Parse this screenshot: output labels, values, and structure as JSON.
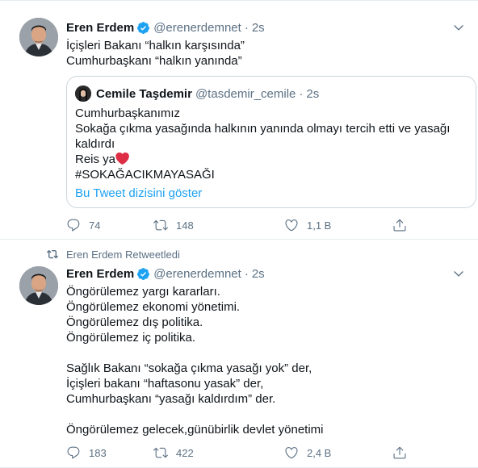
{
  "tweet1": {
    "author_name": "Eren Erdem",
    "handle": "@erenerdemnet",
    "separator": "·",
    "time": "2s",
    "text": "İçişleri Bakanı “halkın karşısında”\nCumhurbaşkanı “halkın yanında”",
    "quote": {
      "author_name": "Cemile Taşdemir",
      "handle": "@tasdemir_cemile",
      "separator": "·",
      "time": "2s",
      "text_before_heart": "Cumhurbaşkanımız\nSokağa çıkma yasağında halkının yanında olmayı tercih etti ve yasağı kaldırdı\nReis ya",
      "text_after_heart": "\n #SOKAĞACIKMAYASAĞI",
      "thread_link": "Bu Tweet dizisini göster"
    },
    "replies": "74",
    "retweets": "148",
    "likes": "1,1 B"
  },
  "tweet2": {
    "retweet_label": "Eren Erdem Retweetledi",
    "author_name": "Eren Erdem",
    "handle": "@erenerdemnet",
    "separator": "·",
    "time": "2s",
    "text": "Öngörülemez yargı kararları.\nÖngörülemez ekonomi yönetimi.\nÖngörülemez dış politika.\nÖngörülemez iç politika.\n\nSağlık Bakanı “sokağa çıkma yasağı yok” der,\nİçişleri bakanı “haftasonu yasak” der,\nCumhurbaşkanı “yasağı kaldırdım” der.\n\nÖngörülemez gelecek,günübirlik devlet yönetimi",
    "replies": "183",
    "retweets": "422",
    "likes": "2,4 B"
  },
  "icons": {
    "verified": "verified-badge-icon",
    "caret": "chevron-down-icon",
    "reply": "reply-icon",
    "retweet": "retweet-icon",
    "like": "heart-icon",
    "share": "share-icon"
  },
  "colors": {
    "accent": "#1da1f2",
    "secondary_text": "#5b7083",
    "border": "#ccd6dd",
    "heart_emoji": "#dd2e44"
  }
}
